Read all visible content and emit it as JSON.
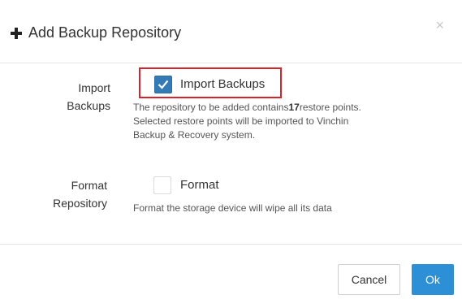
{
  "dialog": {
    "title": "Add Backup Repository",
    "close_glyph": "×"
  },
  "import": {
    "label_line1": "Import",
    "label_line2": "Backups",
    "checkbox_checked": true,
    "option_label": "Import Backups",
    "desc_line1_pre": "The repository to be added contains",
    "desc_count": "17",
    "desc_line1_post": "restore points.",
    "desc_line2": "Selected restore points will be imported to Vinchin",
    "desc_line3": "Backup & Recovery system."
  },
  "format": {
    "label_line1": "Format",
    "label_line2": "Repository",
    "checkbox_checked": false,
    "option_label": "Format",
    "desc": "Format the storage device will wipe all its data"
  },
  "footer": {
    "cancel_label": "Cancel",
    "ok_label": "Ok"
  },
  "colors": {
    "accent": "#2d8fd5",
    "checkbox": "#337ab7",
    "highlight": "#d9232a"
  }
}
